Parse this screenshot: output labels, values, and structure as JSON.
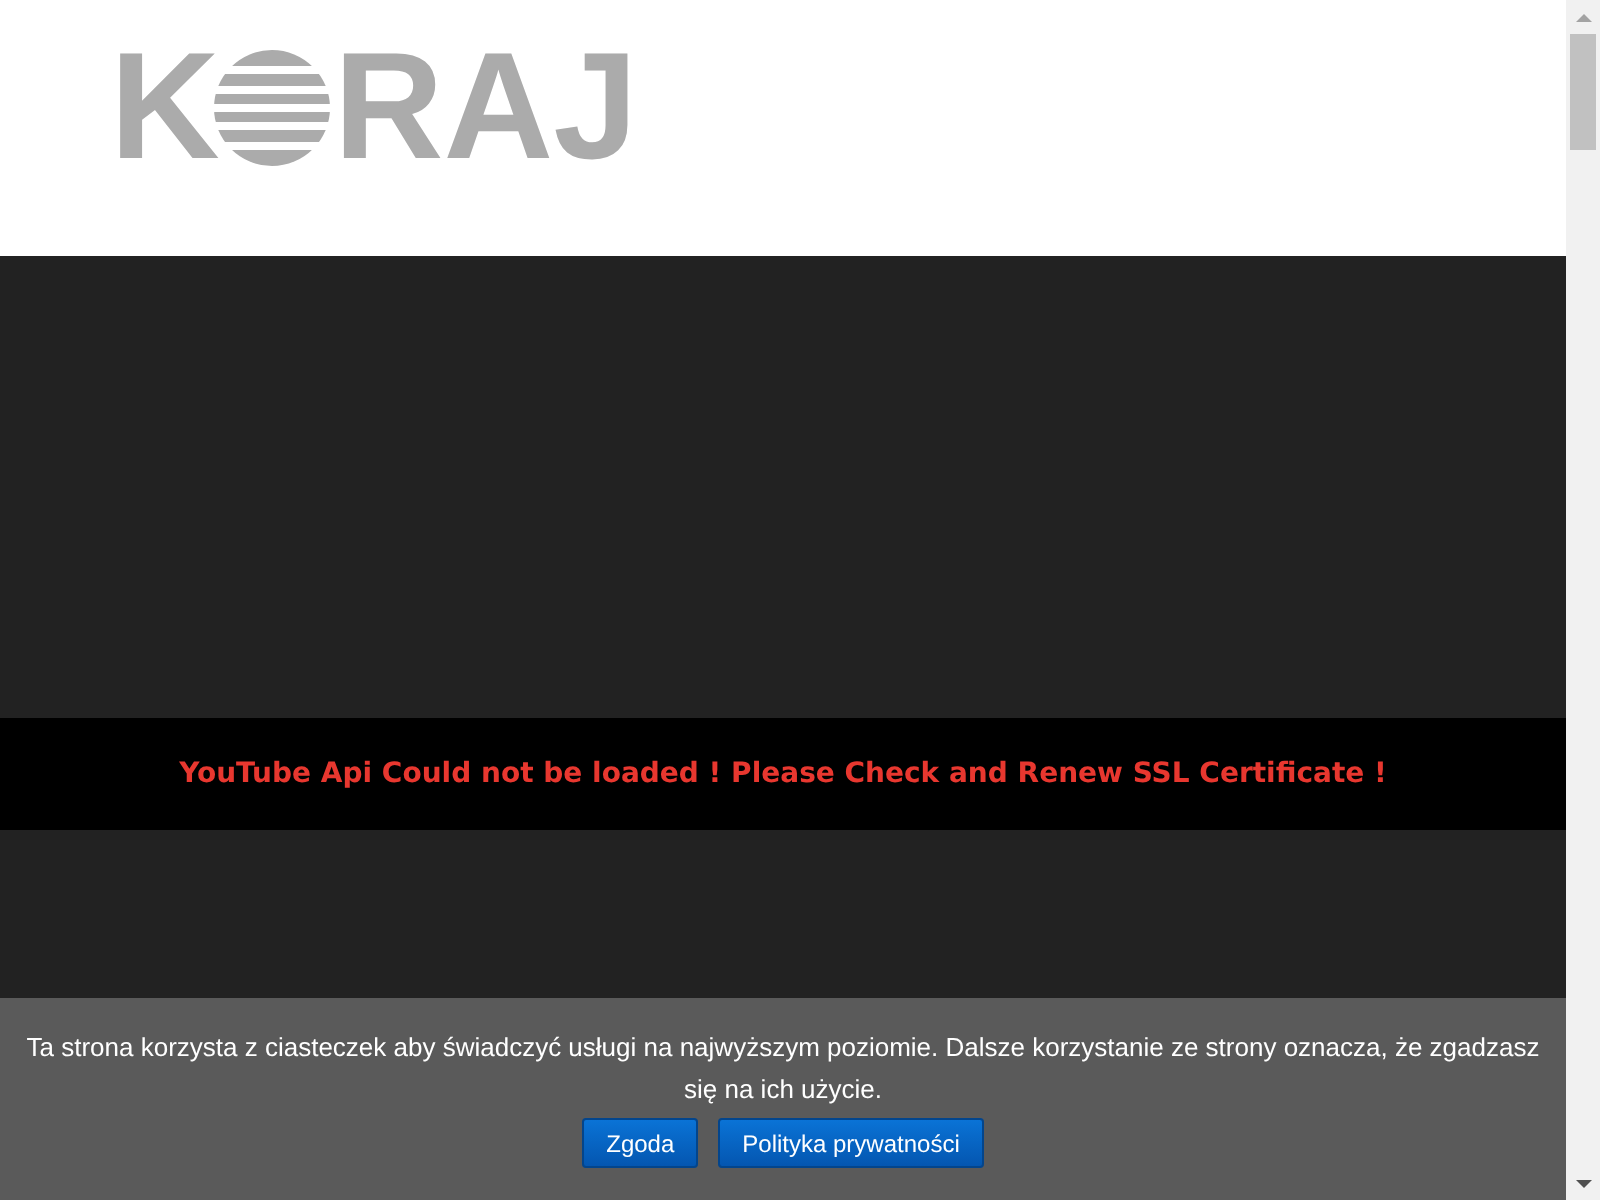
{
  "logo": {
    "before": "K",
    "after": "RAJ"
  },
  "video": {
    "error": "YouTube Api Could not be loaded ! Please Check and Renew SSL Certificate !"
  },
  "cookie_bar": {
    "message": "Ta strona korzysta z ciasteczek aby świadczyć usługi na najwyższym poziomie. Dalsze korzystanie ze strony oznacza, że zgadzasz się na ich użycie.",
    "buttons": [
      "Zgoda",
      "Polityka prywatności"
    ]
  }
}
